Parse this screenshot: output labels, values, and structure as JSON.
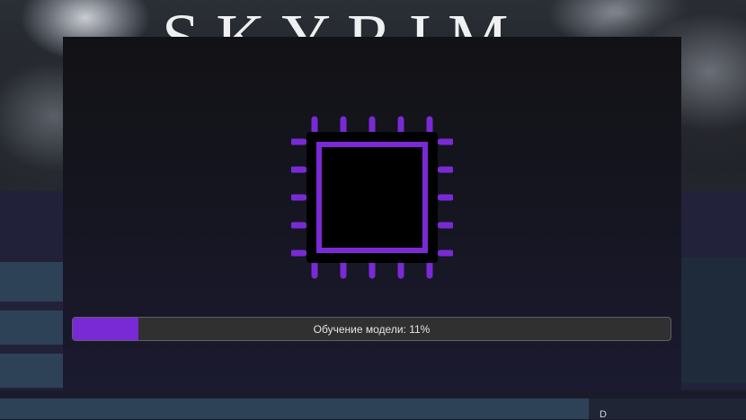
{
  "background": {
    "banner_title": "SKYRIM",
    "bottom_right_text": "D"
  },
  "modal": {
    "icon": "brain-chip-icon",
    "accent_color": "#7a2ad4",
    "progress": {
      "label": "Обучение модели: 11%",
      "percent": 11
    }
  }
}
